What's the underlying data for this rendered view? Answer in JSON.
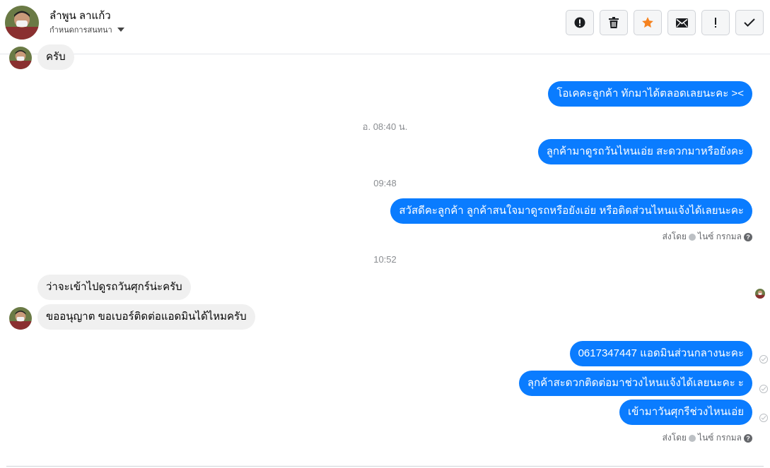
{
  "header": {
    "contact_name": "ลำพูน ลาแก้ว",
    "conversation_action": "กำหนดการสนทนา",
    "toolbar": [
      {
        "name": "mark-spam-button",
        "icon": "alert-circle-icon"
      },
      {
        "name": "delete-button",
        "icon": "trash-icon"
      },
      {
        "name": "star-button",
        "icon": "star-icon"
      },
      {
        "name": "mark-unread-button",
        "icon": "envelope-icon"
      },
      {
        "name": "important-button",
        "icon": "exclamation-icon"
      },
      {
        "name": "mark-done-button",
        "icon": "check-icon"
      }
    ]
  },
  "colors": {
    "outgoing_bubble": "#0a7cff",
    "incoming_bubble": "#f0f0f0",
    "star": "#f5821f"
  },
  "messages": {
    "in_1": "ครับ",
    "out_1": "โอเคคะลูกค้า ทักมาได้ตลอดเลยนะคะ ><",
    "ts_1": "อ. 08:40 น.",
    "out_2": "ลูกค้ามาดูรถวันไหนเอ่ย สะดวกมาหรือยังคะ",
    "ts_2": "09:48",
    "out_3": "สวัสดีคะลูกค้า ลูกค้าสนใจมาดูรถหรือยังเอ่ย หรือติดส่วนไหนแจ้งได้เลยนะคะ",
    "sent_by_label": "ส่งโดย",
    "sender_name": "ไนซ์ กรกมล",
    "ts_3": "10:52",
    "in_2": "ว่าจะเข้าไปดูรถวันศุกร์น่ะครับ",
    "in_3": "ขออนุญาต ขอเบอร์ติดต่อแอดมินได้ไหมครับ",
    "out_4": "0617347447 แอดมินส่วนกลางนะคะ",
    "out_5": "ลุกค้าสะดวกติดต่อมาช่วงไหนแจ้งได้เลยนะคะ ะ",
    "out_6": "เข้ามาวันศุกรืช่วงไหนเอ่ย"
  }
}
